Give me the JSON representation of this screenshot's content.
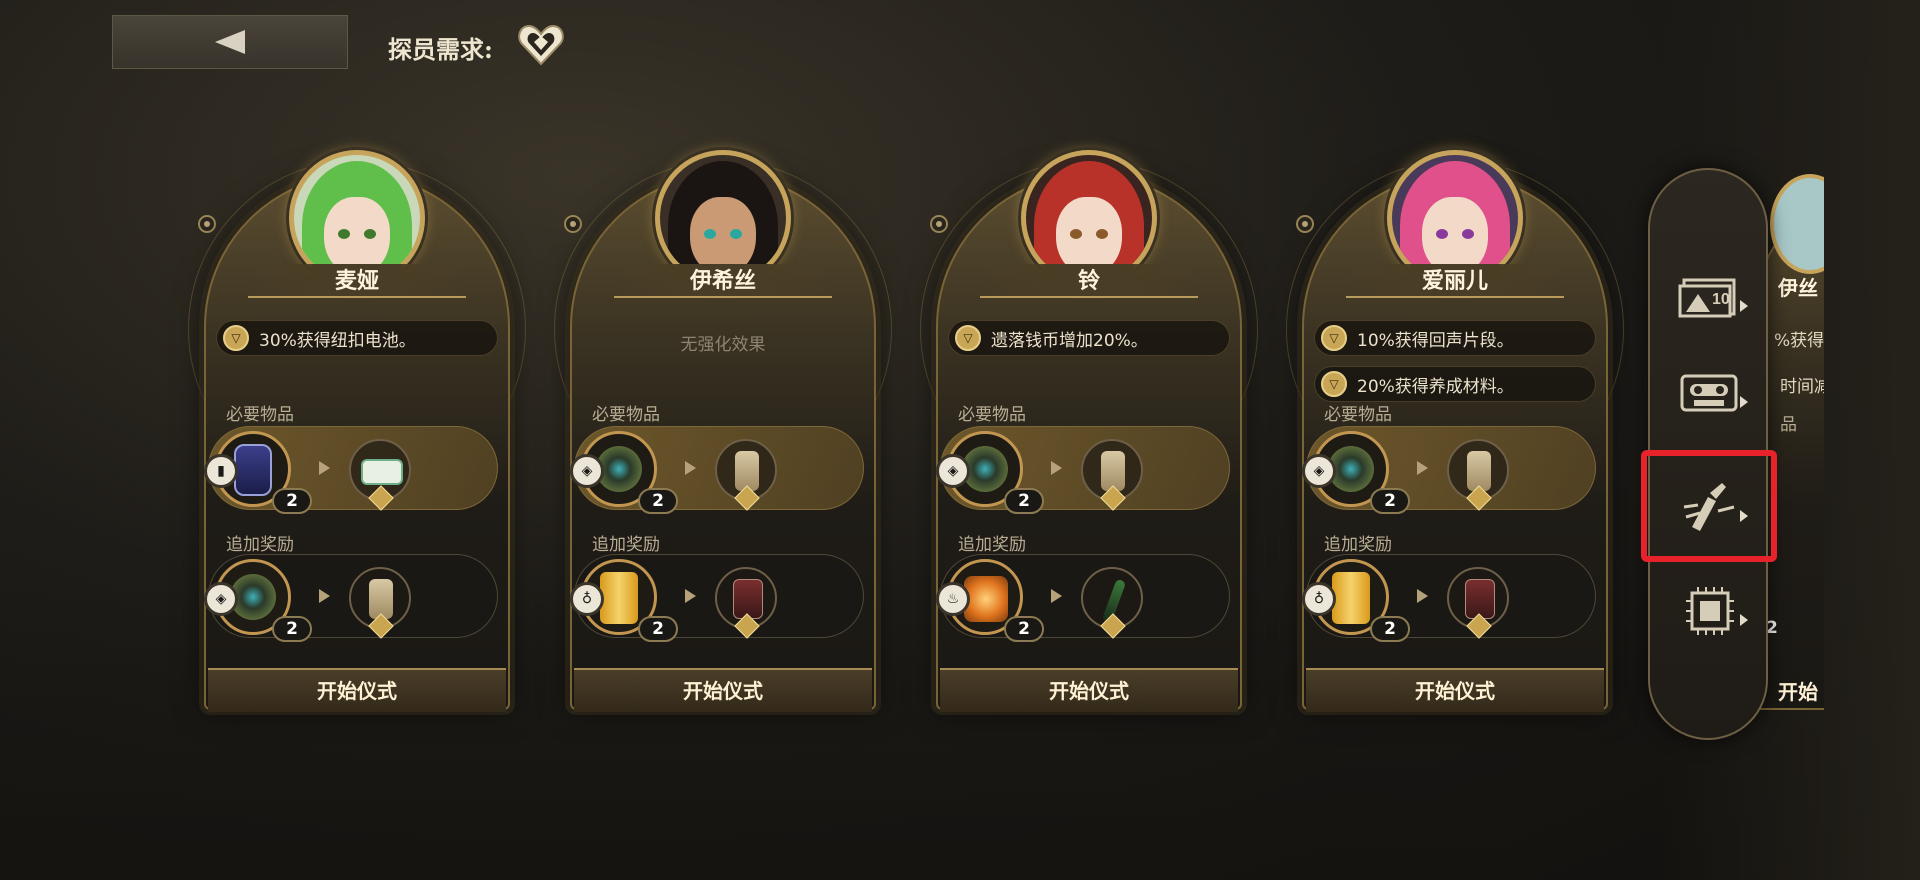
{
  "header": {
    "back_icon": "back-arrow-icon",
    "requirement_label": "探员需求:",
    "requirement_icon": "heart-emblem-icon"
  },
  "labels": {
    "required_items": "必要物品",
    "bonus_rewards": "追加奖励",
    "start_button": "开始仪式"
  },
  "cards": [
    {
      "name": "麦娅",
      "effects": [
        "30%获得纽扣电池。"
      ],
      "no_effect_text": "",
      "required": {
        "tag": "bottle-icon",
        "item": "blue-vase-icon",
        "count": "2",
        "reward": "green-ticket-icon"
      },
      "bonus": {
        "tag": "shield-icon",
        "item": "eye-relic-icon",
        "count": "2",
        "reward": "scroll-icon"
      }
    },
    {
      "name": "伊希丝",
      "effects": [],
      "no_effect_text": "无强化效果",
      "required": {
        "tag": "shield-icon",
        "item": "eye-relic-icon",
        "count": "2",
        "reward": "scroll-icon"
      },
      "bonus": {
        "tag": "cup-icon",
        "item": "yellow-can-icon",
        "count": "2",
        "reward": "red-card-icon"
      }
    },
    {
      "name": "铃",
      "effects": [
        "遗落钱币增加20%。"
      ],
      "no_effect_text": "",
      "required": {
        "tag": "shield-icon",
        "item": "eye-relic-icon",
        "count": "2",
        "reward": "scroll-icon"
      },
      "bonus": {
        "tag": "flame-icon",
        "item": "candle-lantern-icon",
        "count": "2",
        "reward": "green-vial-icon"
      }
    },
    {
      "name": "爱丽儿",
      "effects": [
        "10%获得回声片段。",
        "20%获得养成材料。"
      ],
      "no_effect_text": "",
      "required": {
        "tag": "shield-icon",
        "item": "eye-relic-icon",
        "count": "2",
        "reward": "scroll-icon"
      },
      "bonus": {
        "tag": "cup-icon",
        "item": "yellow-can-icon",
        "count": "2",
        "reward": "red-card-icon"
      }
    }
  ],
  "partial_card": {
    "name": "伊丝",
    "effect_1": "%获得",
    "effect_2": "时间减",
    "label": "品",
    "count": "2",
    "start_button": "开始"
  },
  "side_menu": [
    {
      "icon": "ten-pack-icon"
    },
    {
      "icon": "cassette-icon"
    },
    {
      "icon": "broken-sword-icon",
      "highlighted": true
    },
    {
      "icon": "chip-icon"
    }
  ],
  "colors": {
    "gold": "#c7a45b",
    "highlight": "#e8222a",
    "background": "#1e1c18"
  }
}
